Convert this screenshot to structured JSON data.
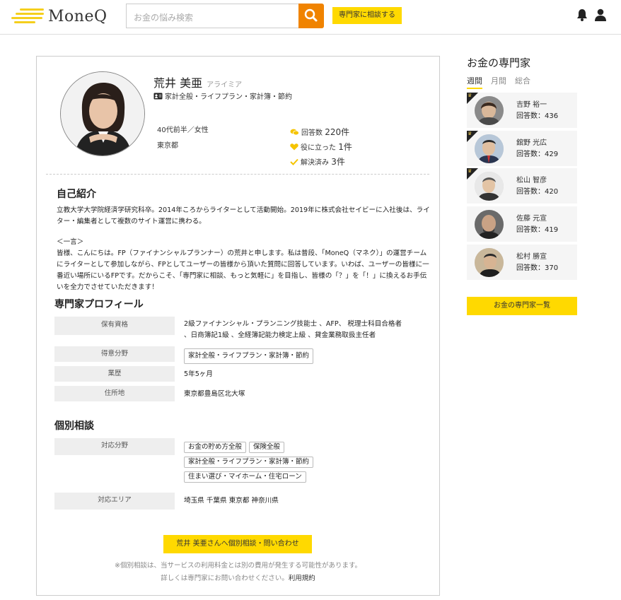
{
  "header": {
    "logo_text": "MoneQ",
    "search_placeholder": "お金の悩み検索",
    "consult_label": "専門家に相談する"
  },
  "profile": {
    "name": "荒井 美亜",
    "kana": "アライミア",
    "category": "家計全般・ライフプラン・家計簿・節約",
    "age_gender": "40代前半／女性",
    "location": "東京都",
    "answers_label": "回答数",
    "answers_value": "220件",
    "helpful_label": "役に立った",
    "helpful_value": "1件",
    "solved_label": "解決済み",
    "solved_value": "3件"
  },
  "intro": {
    "title": "自己紹介",
    "para1": "立教大学大学院経済学研究科卒。2014年ころからライターとして活動開始。2019年に株式会社セイビーに入社後は、ライター・編集者として複数のサイト運営に携わる。",
    "para2_head": "＜一言＞",
    "para2": "皆様、こんにちは。FP（ファイナンシャルプランナー）の荒井と申します。私は普段、「MoneQ（マネク）」の運営チームにライターとして参加しながら、FPとしてユーザーの皆様から頂いた質問に回答しています。いわば、ユーザーの皆様に一番近い場所にいるFPです。だからこそ、「専門家に相談、もっと気軽に」を目指し、皆様の「？」を「！」に換えるお手伝いを全力でさせていただきます！"
  },
  "expert_profile": {
    "title": "専門家プロフィール",
    "qual_label": "保有資格",
    "qual_line1": "2級ファイナンシャル・プランニング技能士 、AFP、 税理士科目合格者",
    "qual_line2": "、日商簿記1級 、全経簿記能力検定上級 、貸金業務取扱主任者",
    "field_label": "得意分野",
    "field_tag": "家計全般・ライフプラン・家計簿・節約",
    "career_label": "業歴",
    "career_value": "5年5ヶ月",
    "address_label": "住所地",
    "address_value": "東京都豊島区北大塚"
  },
  "consultation": {
    "title": "個別相談",
    "area_label": "対応分野",
    "tags": [
      "お金の貯め方全般",
      "保険全般",
      "家計全般・ライフプラン・家計簿・節約",
      "住まい選び・マイホーム・住宅ローン"
    ],
    "region_label": "対応エリア",
    "region_value": "埼玉県 千葉県 東京都 神奈川県",
    "cta": "荒井 美亜さんへ個別相談・問い合わせ",
    "note1": "※個別相談は、当サービスの利用料金とは別の費用が発生する可能性があります。",
    "note2_prefix": "詳しくは専門家にお問い合わせください。",
    "note2_link": "利用規約"
  },
  "sidebar": {
    "title": "お金の専門家",
    "tabs": [
      "週間",
      "月間",
      "総合"
    ],
    "experts": [
      {
        "name": "吉野 裕一",
        "count": "回答数：436",
        "crown": true
      },
      {
        "name": "舘野 光広",
        "count": "回答数：429",
        "crown": true
      },
      {
        "name": "松山 智彦",
        "count": "回答数：420",
        "crown": true
      },
      {
        "name": "佐藤 元宣",
        "count": "回答数：419",
        "crown": false
      },
      {
        "name": "松村 勝宣",
        "count": "回答数：370",
        "crown": false
      }
    ],
    "list_button": "お金の専門家一覧"
  },
  "colors": {
    "accent": "#ffd900",
    "search_button": "#f08300",
    "icon_yellow": "#f5cf1d"
  }
}
